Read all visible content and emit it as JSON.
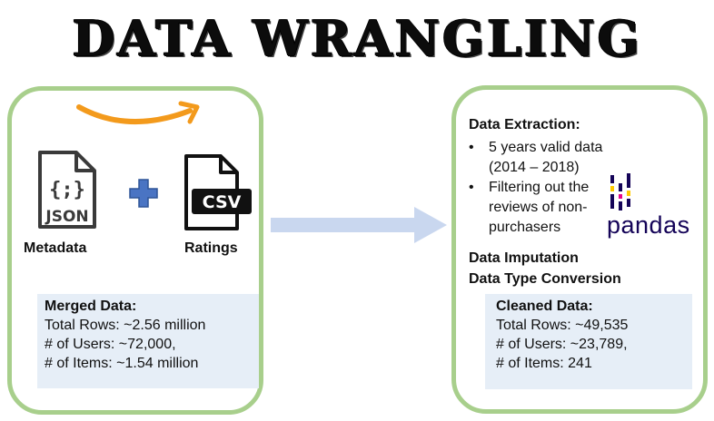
{
  "title": "DATA WRANGLING",
  "left": {
    "json_icon_text": "JSON",
    "json_glyph": "{;}",
    "csv_icon_text": "CSV",
    "metadata_label": "Metadata",
    "ratings_label": "Ratings",
    "merged": {
      "header": "Merged Data:",
      "lines": [
        "Total Rows: ~2.56 million",
        "# of Users: ~72,000,",
        "# of Items: ~1.54 million"
      ]
    }
  },
  "right": {
    "extraction_header": "Data Extraction:",
    "bullets": [
      "5 years valid data (2014 – 2018)",
      "Filtering out the reviews of non-purchasers"
    ],
    "imputation": "Data Imputation",
    "type_conversion": "Data Type Conversion",
    "pandas_text": "pandas",
    "cleaned": {
      "header": "Cleaned Data:",
      "lines": [
        "Total Rows: ~49,535",
        "# of Users: ~23,789,",
        "# of Items: 241"
      ]
    }
  },
  "colors": {
    "panel_border": "#a8cf8c",
    "info_bg": "#e6eef7",
    "arrow": "#c9d7ef",
    "plus": "#4a74c3",
    "amazon_smile": "#f39a1c",
    "pandas_navy": "#150458",
    "pandas_accent": "#ffca00",
    "pandas_pink": "#e70488"
  },
  "icons": [
    "amazon-smile-icon",
    "json-file-icon",
    "plus-icon",
    "csv-file-icon",
    "pandas-logo-icon",
    "right-arrow-icon"
  ]
}
